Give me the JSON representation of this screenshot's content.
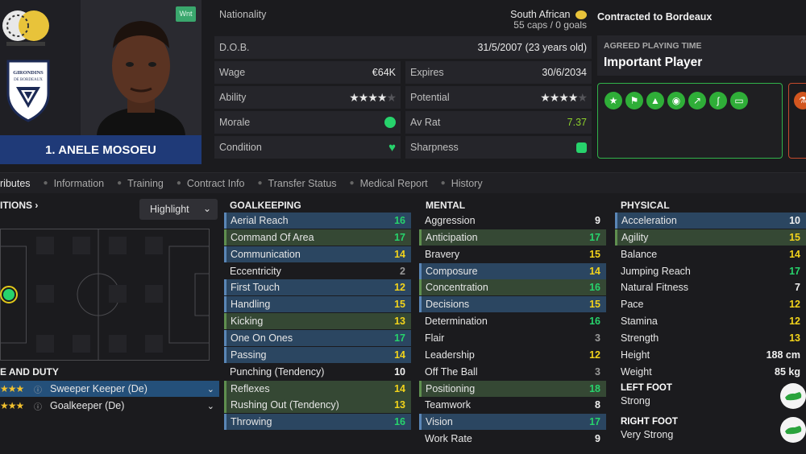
{
  "header": {
    "wnt_badge": "Wnt",
    "player_name": "1. ANELE MOSOEU",
    "club_crest_text": "GIRONDINS DE BORDEAUX"
  },
  "info": {
    "nationality_label": "Nationality",
    "nationality_value": "South African",
    "caps_goals": "55 caps / 0 goals",
    "dob_label": "D.O.B.",
    "dob_value": "31/5/2007 (23 years old)",
    "wage_label": "Wage",
    "wage_value": "€64K",
    "expires_label": "Expires",
    "expires_value": "30/6/2034",
    "ability_label": "Ability",
    "ability_stars": 4,
    "potential_label": "Potential",
    "potential_stars": 4,
    "morale_label": "Morale",
    "avrat_label": "Av Rat",
    "avrat_value": "7.37",
    "condition_label": "Condition",
    "sharpness_label": "Sharpness"
  },
  "contract": {
    "contracted_to": "Contracted to Bordeaux",
    "apt_label": "AGREED PLAYING TIME",
    "apt_value": "Important Player"
  },
  "tabs": [
    "ributes",
    "Information",
    "Training",
    "Contract Info",
    "Transfer Status",
    "Medical Report",
    "History"
  ],
  "positions": {
    "title": "ITIONS",
    "highlight_label": "Highlight"
  },
  "roles": {
    "title": "E AND DUTY",
    "items": [
      {
        "label": "Sweeper Keeper (De)",
        "selected": true
      },
      {
        "label": "Goalkeeper (De)",
        "selected": false
      }
    ]
  },
  "goalkeeping": {
    "title": "GOALKEEPING",
    "attrs": [
      {
        "name": "Aerial Reach",
        "value": "16",
        "hl": "blue"
      },
      {
        "name": "Command Of Area",
        "value": "17",
        "hl": "green"
      },
      {
        "name": "Communication",
        "value": "14",
        "hl": "blue"
      },
      {
        "name": "Eccentricity",
        "value": "2",
        "hl": ""
      },
      {
        "name": "First Touch",
        "value": "12",
        "hl": "blue"
      },
      {
        "name": "Handling",
        "value": "15",
        "hl": "blue"
      },
      {
        "name": "Kicking",
        "value": "13",
        "hl": "green"
      },
      {
        "name": "One On Ones",
        "value": "17",
        "hl": "blue"
      },
      {
        "name": "Passing",
        "value": "14",
        "hl": "blue"
      },
      {
        "name": "Punching (Tendency)",
        "value": "10",
        "hl": ""
      },
      {
        "name": "Reflexes",
        "value": "14",
        "hl": "green"
      },
      {
        "name": "Rushing Out (Tendency)",
        "value": "13",
        "hl": "green"
      },
      {
        "name": "Throwing",
        "value": "16",
        "hl": "blue"
      }
    ]
  },
  "mental": {
    "title": "MENTAL",
    "attrs": [
      {
        "name": "Aggression",
        "value": "9",
        "hl": ""
      },
      {
        "name": "Anticipation",
        "value": "17",
        "hl": "green"
      },
      {
        "name": "Bravery",
        "value": "15",
        "hl": ""
      },
      {
        "name": "Composure",
        "value": "14",
        "hl": "blue"
      },
      {
        "name": "Concentration",
        "value": "16",
        "hl": "green"
      },
      {
        "name": "Decisions",
        "value": "15",
        "hl": "blue"
      },
      {
        "name": "Determination",
        "value": "16",
        "hl": ""
      },
      {
        "name": "Flair",
        "value": "3",
        "hl": ""
      },
      {
        "name": "Leadership",
        "value": "12",
        "hl": ""
      },
      {
        "name": "Off The Ball",
        "value": "3",
        "hl": ""
      },
      {
        "name": "Positioning",
        "value": "18",
        "hl": "green"
      },
      {
        "name": "Teamwork",
        "value": "8",
        "hl": ""
      },
      {
        "name": "Vision",
        "value": "17",
        "hl": "blue"
      },
      {
        "name": "Work Rate",
        "value": "9",
        "hl": ""
      }
    ]
  },
  "physical": {
    "title": "PHYSICAL",
    "attrs": [
      {
        "name": "Acceleration",
        "value": "10",
        "hl": "blue"
      },
      {
        "name": "Agility",
        "value": "15",
        "hl": "green"
      },
      {
        "name": "Balance",
        "value": "14",
        "hl": ""
      },
      {
        "name": "Jumping Reach",
        "value": "17",
        "hl": ""
      },
      {
        "name": "Natural Fitness",
        "value": "7",
        "hl": ""
      },
      {
        "name": "Pace",
        "value": "12",
        "hl": ""
      },
      {
        "name": "Stamina",
        "value": "12",
        "hl": ""
      },
      {
        "name": "Strength",
        "value": "13",
        "hl": ""
      },
      {
        "name": "Height",
        "value": "188 cm",
        "hl": ""
      },
      {
        "name": "Weight",
        "value": "85 kg",
        "hl": ""
      }
    ],
    "left_foot_label": "LEFT FOOT",
    "left_foot_value": "Strong",
    "right_foot_label": "RIGHT FOOT",
    "right_foot_value": "Very Strong"
  },
  "colors": {
    "green": "#27d36c",
    "yellow": "#f2d31b",
    "blue_highlight": "#2b4661",
    "green_highlight": "#354834",
    "name_bar": "#1f3a78"
  }
}
